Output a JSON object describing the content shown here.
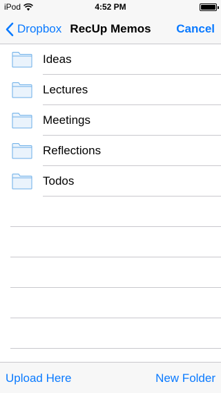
{
  "status_bar": {
    "carrier": "iPod",
    "time": "4:52 PM",
    "wifi_icon": "wifi-icon",
    "battery_icon": "battery-icon",
    "battery_level": 1.0
  },
  "nav": {
    "back_label": "Dropbox",
    "back_icon": "chevron-left-icon",
    "title": "RecUp Memos",
    "cancel_label": "Cancel"
  },
  "folders": [
    {
      "name": "Ideas",
      "icon": "folder-icon"
    },
    {
      "name": "Lectures",
      "icon": "folder-icon"
    },
    {
      "name": "Meetings",
      "icon": "folder-icon"
    },
    {
      "name": "Reflections",
      "icon": "folder-icon"
    },
    {
      "name": "Todos",
      "icon": "folder-icon"
    }
  ],
  "toolbar": {
    "upload_label": "Upload Here",
    "new_folder_label": "New Folder"
  },
  "colors": {
    "accent": "#0a7aff",
    "bar_background": "#f7f7f7",
    "separator": "#c8c7cc",
    "folder_fill": "#eaf3fc",
    "folder_stroke": "#6aaee8"
  }
}
